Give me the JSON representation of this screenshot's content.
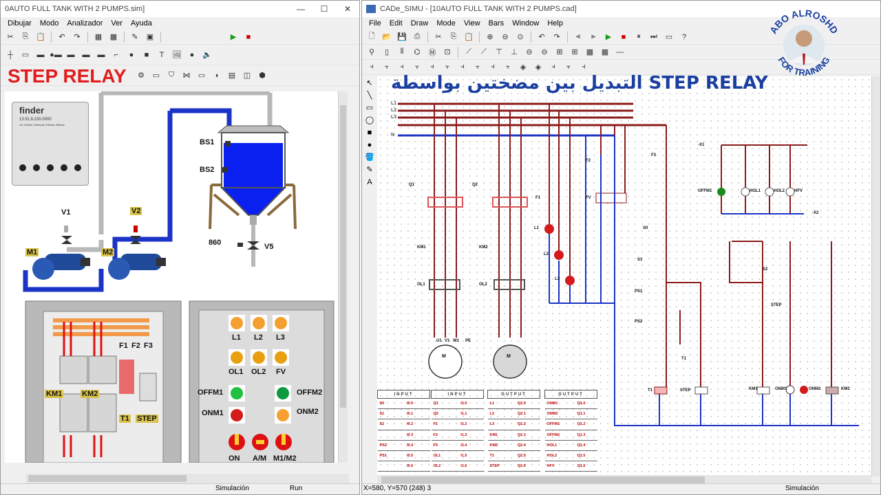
{
  "left_window": {
    "title": "0AUTO FULL TANK WITH 2 PUMPS.sim]",
    "menu": [
      "Dibujar",
      "Modo",
      "Analizador",
      "Ver",
      "Ayuda"
    ],
    "overlay_title": "STEP RELAY",
    "status": {
      "mode": "Simulación",
      "run": "Run"
    },
    "device": {
      "brand": "finder",
      "model": "13.91.8.230.0000",
      "rating": "Ue 230Vac  24Vac/dc 230Vac  250Vac",
      "terminals": [
        "4",
        "L",
        "B",
        "N",
        "T"
      ]
    },
    "tank": {
      "sensor1": "BS1",
      "sensor2": "BS2",
      "level_code": "860",
      "valve": "V5"
    },
    "valves": [
      "V1",
      "V2"
    ],
    "pumps": [
      "M1",
      "M2"
    ],
    "cabinet_left": {
      "labels": [
        "F1",
        "F2",
        "F3",
        "KM1",
        "KM2",
        "T1",
        "STEP"
      ]
    },
    "cabinet_right": {
      "lamp_row1": [
        "L1",
        "L2",
        "L3"
      ],
      "lamp_row2": [
        "OL1",
        "OL2",
        "FV"
      ],
      "left_labels": [
        "OFFM1",
        "ONM1"
      ],
      "right_labels": [
        "OFFM2",
        "ONM2"
      ],
      "switches": [
        "ON",
        "A/M",
        "M1/M2"
      ]
    }
  },
  "right_window": {
    "title": "CADe_SIMU - [10AUTO FULL TANK WITH 2 PUMPS.cad]",
    "menu": [
      "File",
      "Edit",
      "Draw",
      "Mode",
      "View",
      "Bars",
      "Window",
      "Help"
    ],
    "diagram_title": "التبديل بين مضختين بواسطة STEP RELAY",
    "badge": {
      "top": "ABO ALROSHD",
      "bottom": "FOR TRAINING"
    },
    "status": {
      "coords": "X=580, Y=570 (248) 3",
      "mode": "Simulación"
    },
    "power_lines": [
      "L1",
      "L2",
      "L3",
      "N"
    ],
    "labels": {
      "q1": "Q1",
      "q2": "Q2",
      "km1": "KM1",
      "km2": "KM2",
      "ol1": "OL1",
      "ol2": "OL2",
      "f1": "F1",
      "f2": "F2",
      "f3": "F3",
      "fv": "FV",
      "l1": "L1",
      "l2": "L2",
      "l3": "L3",
      "s0": "S0",
      "s1": "S1",
      "s2": "S2",
      "ps1": "PS1",
      "ps2": "PS2",
      "t1": "T1",
      "step": "STEP",
      "offm1": "OFFM1",
      "hol1": "HOL1",
      "hol2": "HOL2",
      "hfv": "HFV",
      "onm1": "ONM1",
      "onm2": "ONM2",
      "x1_tag": "-X1",
      "x2_tag": "-X2",
      "u1": "U1",
      "v1": "V1",
      "w1": "W1",
      "pe": "PE",
      "m": "M"
    },
    "io_tables": [
      {
        "header": "INPUT",
        "rows": [
          [
            "S0",
            "I0.0"
          ],
          [
            "S1",
            "I0.1"
          ],
          [
            "S2",
            "I0.2"
          ],
          [
            "",
            "I0.3"
          ],
          [
            "PS2",
            "I0.4"
          ],
          [
            "PS1",
            "I0.5"
          ],
          [
            "",
            "I0.6"
          ]
        ]
      },
      {
        "header": "INPUT",
        "rows": [
          [
            "Q1",
            "I1.0"
          ],
          [
            "Q2",
            "I1.1"
          ],
          [
            "F1",
            "I1.2"
          ],
          [
            "F2",
            "I1.3"
          ],
          [
            "F3",
            "I1.4"
          ],
          [
            "OL1",
            "I1.5"
          ],
          [
            "OL2",
            "I1.6"
          ]
        ]
      },
      {
        "header": "OUTPUT",
        "rows": [
          [
            "L1",
            "Q2.0"
          ],
          [
            "L2",
            "Q2.1"
          ],
          [
            "L3",
            "Q2.2"
          ],
          [
            "KM1",
            "Q2.3"
          ],
          [
            "KM2",
            "Q2.4"
          ],
          [
            "T1",
            "Q2.5"
          ],
          [
            "STEP",
            "Q2.6"
          ]
        ]
      },
      {
        "header": "OUTPUT",
        "rows": [
          [
            "ONM1",
            "Q1.0"
          ],
          [
            "ONM2",
            "Q1.1"
          ],
          [
            "OFFM1",
            "Q1.2"
          ],
          [
            "OFFM2",
            "Q1.3"
          ],
          [
            "HOL1",
            "Q1.4"
          ],
          [
            "HOL2",
            "Q1.5"
          ],
          [
            "HFV",
            "Q1.6"
          ]
        ]
      }
    ]
  },
  "icons": {
    "left_tools_row1": [
      "cut-icon",
      "copy-icon",
      "paste-icon",
      "undo-icon",
      "redo-icon",
      "grid-icon",
      "grid2-icon",
      "pen-icon",
      "device-icon",
      "play-icon",
      "stop-icon"
    ],
    "right_tools_row1": [
      "new-icon",
      "open-icon",
      "save-icon",
      "print-icon",
      "cut-icon",
      "copy-icon",
      "paste-icon",
      "zoom-in-icon",
      "zoom-out-icon",
      "undo-icon",
      "redo-icon",
      "play-icon",
      "stop-icon",
      "pause-icon",
      "help-icon"
    ]
  },
  "colors": {
    "red_wire": "#8b1a1a",
    "blue_wire": "#1b33c7",
    "title_blue": "#1a3fa0",
    "overlay_red": "#e21b1b",
    "tank_water": "#0a20f0"
  }
}
